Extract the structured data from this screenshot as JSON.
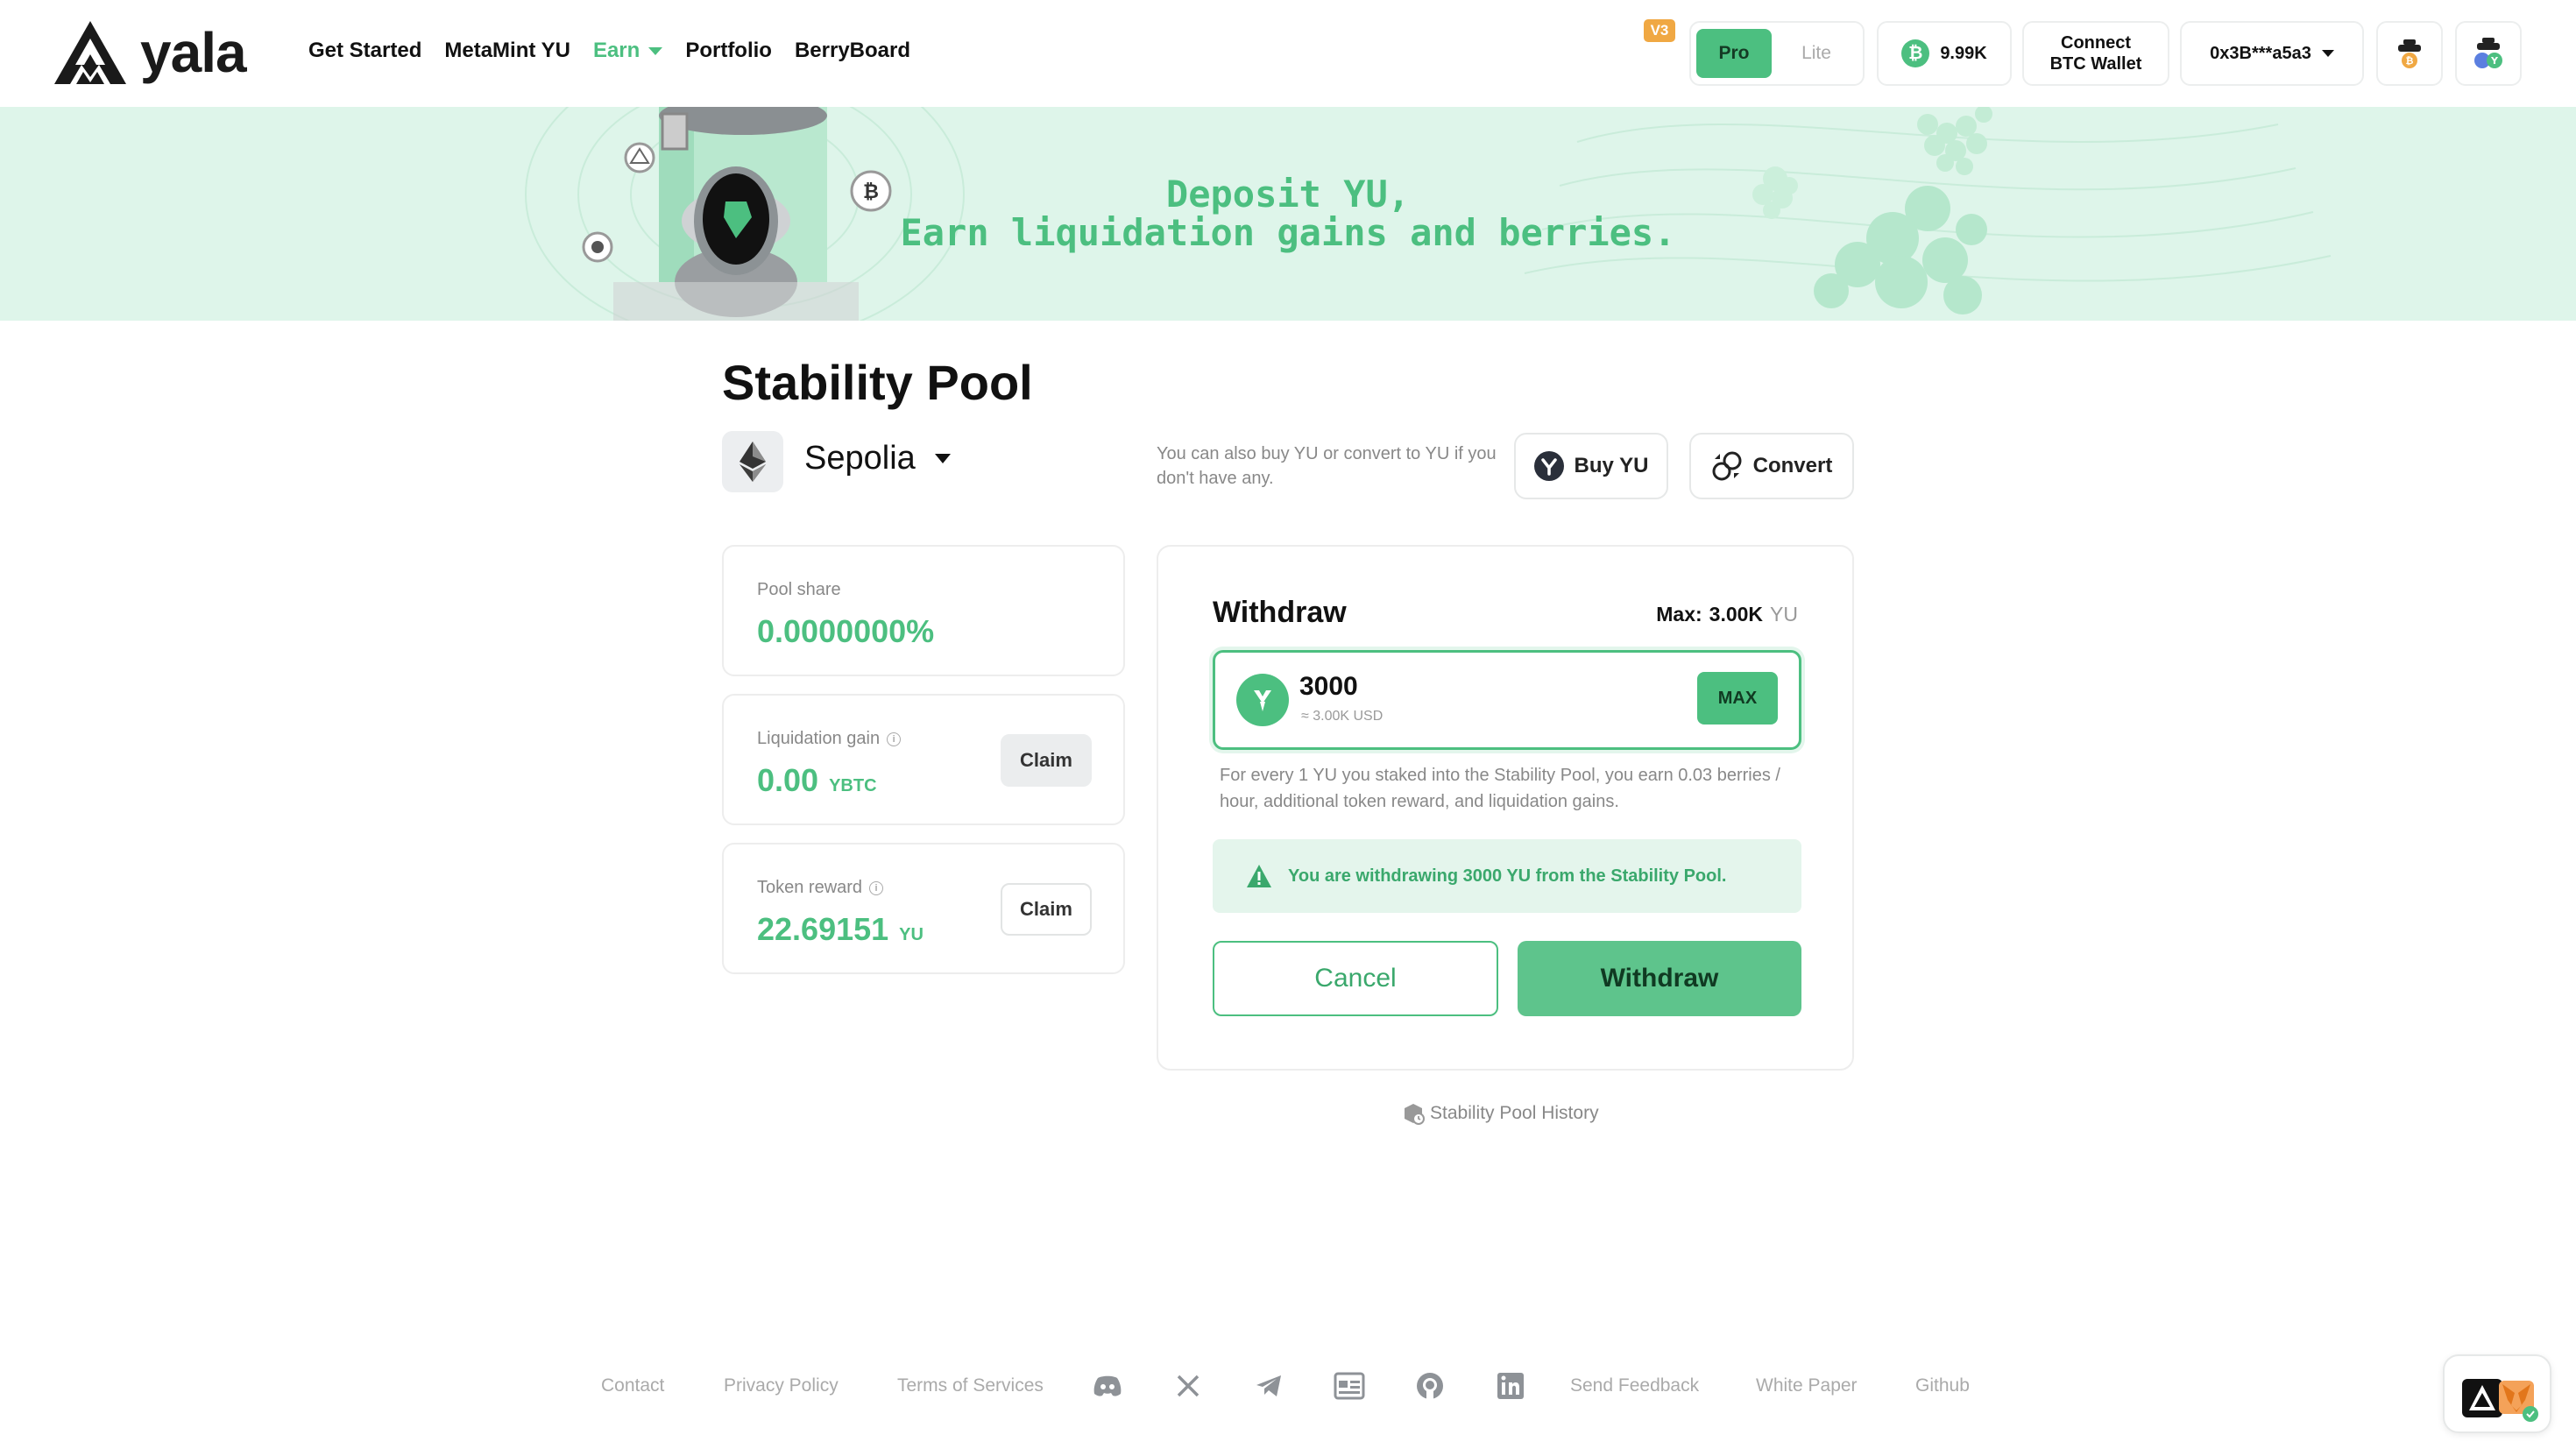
{
  "header": {
    "brand": "yala",
    "nav": [
      {
        "label": "Get Started"
      },
      {
        "label": "MetaMint YU"
      },
      {
        "label": "Earn"
      },
      {
        "label": "Portfolio"
      },
      {
        "label": "BerryBoard"
      }
    ],
    "version_badge": "V3",
    "mode_toggle": {
      "pro": "Pro",
      "lite": "Lite",
      "selected": "Pro"
    },
    "btc_balance": "9.99K",
    "connect_btc": {
      "line1": "Connect",
      "line2": "BTC Wallet"
    },
    "address": "0x3B***a5a3"
  },
  "banner": {
    "line1": "Deposit YU,",
    "line2": "Earn liquidation gains and berries."
  },
  "main": {
    "title": "Stability Pool",
    "network": "Sepolia",
    "hint": "You can also buy YU or convert to YU if you don't have any.",
    "buy_label": "Buy YU",
    "convert_label": "Convert"
  },
  "stats": {
    "pool_share": {
      "label": "Pool share",
      "value": "0.0000000%"
    },
    "liquidation_gain": {
      "label": "Liquidation gain",
      "value": "0.00",
      "unit": "YBTC",
      "claim": "Claim"
    },
    "token_reward": {
      "label": "Token reward",
      "value": "22.69151",
      "unit": "YU",
      "claim": "Claim"
    }
  },
  "withdraw": {
    "title": "Withdraw",
    "max_label": "Max:",
    "max_value": "3.00K",
    "max_unit": "YU",
    "amount": "3000",
    "amount_usd": "≈ 3.00K USD",
    "max_button": "MAX",
    "earn_note": "For every 1 YU you staked into the Stability Pool, you earn 0.03 berries / hour, additional token reward, and liquidation gains.",
    "alert": "You are withdrawing 3000 YU from the Stability Pool.",
    "cancel": "Cancel",
    "confirm": "Withdraw"
  },
  "history_link": "Stability Pool History",
  "footer": {
    "contact": "Contact",
    "privacy": "Privacy Policy",
    "terms": "Terms of Services",
    "feedback": "Send Feedback",
    "whitepaper": "White Paper",
    "github": "Github"
  },
  "colors": {
    "accent": "#4cbf80",
    "banner_bg": "#def5ea",
    "badge": "#f0a843"
  }
}
